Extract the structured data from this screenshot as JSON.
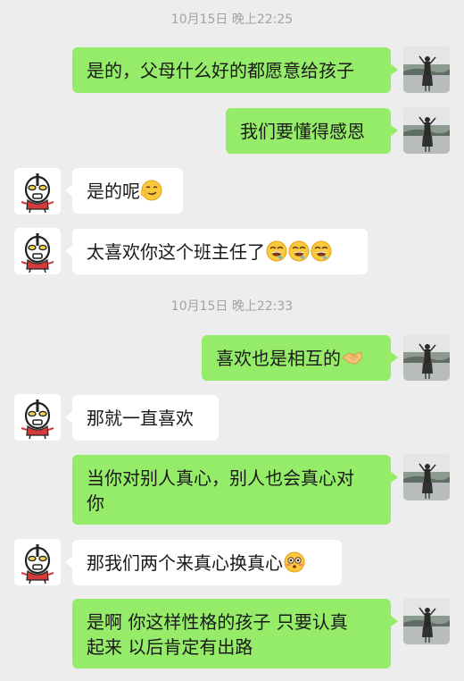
{
  "timestamps": [
    "10月15日 晚上22:25",
    "10月15日 晚上22:33"
  ],
  "messages": [
    {
      "text": "是的，父母什么好的都愿意给孩子"
    },
    {
      "text": "我们要懂得感恩"
    },
    {
      "text": "是的呢",
      "emoji": "smirk-emoji"
    },
    {
      "text": "太喜欢你这个班主任了",
      "emoji": "drooling-emoji-x3"
    },
    {
      "text": "喜欢也是相互的",
      "emoji": "handshake-emoji"
    },
    {
      "text": "那就一直喜欢"
    },
    {
      "line1": "当你对别人真心，别人也会真心对",
      "line2": "你"
    },
    {
      "text": "那我们两个来真心换真心",
      "emoji": "flushed-emoji"
    },
    {
      "line1": "是啊 你这样性格的孩子 只要认真",
      "line2": "起来 以后肯定有出路"
    }
  ],
  "colors": {
    "background": "#ededed",
    "outgoing_bubble": "#95ec69",
    "incoming_bubble": "#ffffff",
    "timestamp_text": "#a3a3a3"
  },
  "avatars": {
    "self": "photo-avatar-woman-lakeside",
    "other": "cartoon-avatar-ultraman"
  }
}
